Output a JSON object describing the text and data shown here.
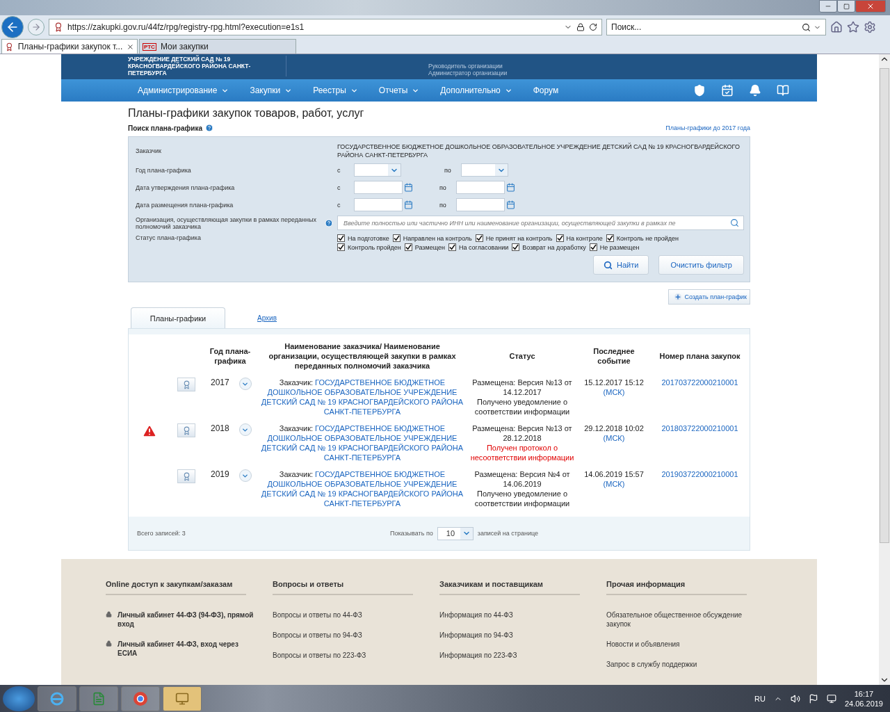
{
  "browser": {
    "url": "https://zakupki.gov.ru/44fz/rpg/registry-rpg.html?execution=e1s1",
    "search_placeholder": "Поиск...",
    "tabs": [
      {
        "title": "Планы-графики закупок т...",
        "selected": true,
        "closable": true
      },
      {
        "title": "Мои закупки",
        "selected": false,
        "closable": false,
        "badge": "РТС"
      }
    ]
  },
  "header": {
    "org_lines": [
      "УЧРЕЖДЕНИЕ ДЕТСКИЙ САД № 19",
      "КРАСНОГВАРДЕЙСКОГО РАЙОНА САНКТ-",
      "ПЕТЕРБУРГА"
    ],
    "roles": [
      "Руководитель организации",
      "Администратор организации"
    ]
  },
  "nav": {
    "items": [
      {
        "label": "Администрирование",
        "dropdown": true
      },
      {
        "label": "Закупки",
        "dropdown": true
      },
      {
        "label": "Реестры",
        "dropdown": true
      },
      {
        "label": "Отчеты",
        "dropdown": true
      },
      {
        "label": "Дополнительно",
        "dropdown": true
      },
      {
        "label": "Форум",
        "dropdown": false
      }
    ]
  },
  "page": {
    "title": "Планы-графики закупок товаров, работ, услуг",
    "search_heading": "Поиск плана-графика",
    "old_link": "Планы-графики до 2017 года"
  },
  "filter": {
    "customer_label": "Заказчик",
    "customer_value": "ГОСУДАРСТВЕННОЕ БЮДЖЕТНОЕ ДОШКОЛЬНОЕ ОБРАЗОВАТЕЛЬНОЕ УЧРЕЖДЕНИЕ ДЕТСКИЙ САД № 19 КРАСНОГВАРДЕЙСКОГО РАЙОНА САНКТ-ПЕТЕРБУРГА",
    "ranges": [
      {
        "label": "Год плана-графика",
        "kind": "select",
        "from": "с",
        "to": "по"
      },
      {
        "label": "Дата утверждения плана-графика",
        "kind": "date",
        "from": "с",
        "to": "по"
      },
      {
        "label": "Дата размещения плана-графика",
        "kind": "date",
        "from": "с",
        "to": "по"
      }
    ],
    "org_label": "Организация, осуществляющая закупки в рамках переданных полномочий заказчика",
    "org_placeholder": "Введите полностью или частично ИНН или наименование организации, осуществляющей закупки в рамках пе",
    "status_label": "Статус плана-графика",
    "statuses": [
      [
        {
          "label": "На подготовке",
          "checked": true
        },
        {
          "label": "Направлен на контроль",
          "checked": true
        },
        {
          "label": "Не принят на контроль",
          "checked": true
        },
        {
          "label": "На контроле",
          "checked": true
        },
        {
          "label": "Контроль не пройден",
          "checked": true
        }
      ],
      [
        {
          "label": "Контроль пройден",
          "checked": true
        },
        {
          "label": "Размещен",
          "checked": true
        },
        {
          "label": "На согласовании",
          "checked": true
        },
        {
          "label": "Возврат на доработку",
          "checked": true
        },
        {
          "label": "Не размещен",
          "checked": true
        }
      ]
    ],
    "find_button": "Найти",
    "clear_button": "Очистить фильтр"
  },
  "create_button": "Создать план-график",
  "tabs": [
    {
      "label": "Планы-графики",
      "selected": true
    },
    {
      "label": "Архив",
      "selected": false
    }
  ],
  "table": {
    "columns": [
      "Год плана-графика",
      "Наименование заказчика/ Наименование организации, осуществляющей закупки в рамках переданных полномочий заказчика",
      "Статус",
      "Последнее событие",
      "Номер плана закупок"
    ],
    "rows": [
      {
        "warning": false,
        "year": "2017",
        "customer_prefix": "Заказчик:",
        "customer": "ГОСУДАРСТВЕННОЕ БЮДЖЕТНОЕ ДОШКОЛЬНОЕ ОБРАЗОВАТЕЛЬНОЕ УЧРЕЖДЕНИЕ ДЕТСКИЙ САД № 19 КРАСНОГВАРДЕЙСКОГО РАЙОНА САНКТ-ПЕТЕРБУРГА",
        "status": "Размещена: Версия №13 от 14.12.2017",
        "status_note": "Получено уведомление о соответствии информации",
        "alert": false,
        "event": "15.12.2017 15:12",
        "event_tz": "(МСК)",
        "number": "201703722000210001"
      },
      {
        "warning": true,
        "year": "2018",
        "customer_prefix": "Заказчик:",
        "customer": "ГОСУДАРСТВЕННОЕ БЮДЖЕТНОЕ ДОШКОЛЬНОЕ ОБРАЗОВАТЕЛЬНОЕ УЧРЕЖДЕНИЕ ДЕТСКИЙ САД № 19 КРАСНОГВАРДЕЙСКОГО РАЙОНА САНКТ-ПЕТЕРБУРГА",
        "status": "Размещена: Версия №13 от 28.12.2018",
        "status_note": "Получен протокол о несоответствии информации",
        "alert": true,
        "event": "29.12.2018 10:02",
        "event_tz": "(МСК)",
        "number": "201803722000210001"
      },
      {
        "warning": false,
        "year": "2019",
        "customer_prefix": "Заказчик:",
        "customer": "ГОСУДАРСТВЕННОЕ БЮДЖЕТНОЕ ДОШКОЛЬНОЕ ОБРАЗОВАТЕЛЬНОЕ УЧРЕЖДЕНИЕ ДЕТСКИЙ САД № 19 КРАСНОГВАРДЕЙСКОГО РАЙОНА САНКТ-ПЕТЕРБУРГА",
        "status": "Размещена: Версия №4 от 14.06.2019",
        "status_note": "Получено уведомление о соответствии информации",
        "alert": false,
        "event": "14.06.2019 15:57",
        "event_tz": "(МСК)",
        "number": "201903722000210001"
      }
    ]
  },
  "pager": {
    "total": "Всего записей: 3",
    "show_label": "Показывать по",
    "per_page": "10",
    "suffix": "записей на странице"
  },
  "footer": [
    {
      "heading": "Online доступ к закупкам/заказам",
      "links": [
        {
          "text": "Личный кабинет 44-ФЗ (94-ФЗ), прямой вход",
          "locked": true
        },
        {
          "text": "Личный кабинет 44-ФЗ, вход через ЕСИА",
          "locked": true
        }
      ]
    },
    {
      "heading": "Вопросы и ответы",
      "links": [
        {
          "text": "Вопросы и ответы по 44-ФЗ",
          "locked": false
        },
        {
          "text": "Вопросы и ответы по 94-ФЗ",
          "locked": false
        },
        {
          "text": "Вопросы и ответы по 223-ФЗ",
          "locked": false
        }
      ]
    },
    {
      "heading": "Заказчикам и поставщикам",
      "links": [
        {
          "text": "Информация по 44-ФЗ",
          "locked": false
        },
        {
          "text": "Информация по 94-ФЗ",
          "locked": false
        },
        {
          "text": "Информация по 223-ФЗ",
          "locked": false
        }
      ]
    },
    {
      "heading": "Прочая информация",
      "links": [
        {
          "text": "Обязательное общественное обсуждение закупок",
          "locked": false
        },
        {
          "text": "Новости и объявления",
          "locked": false
        },
        {
          "text": "Запрос в службу поддержки",
          "locked": false
        }
      ]
    }
  ],
  "taskbar": {
    "lang": "RU",
    "time": "16:17",
    "date": "24.06.2019"
  }
}
